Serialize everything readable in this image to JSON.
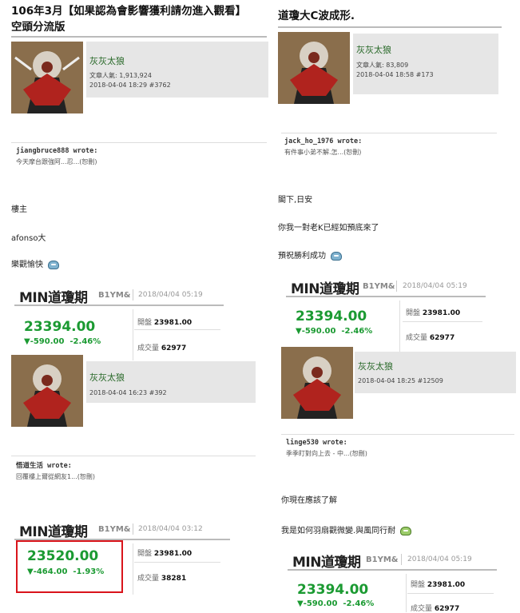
{
  "left": {
    "title_line1": "106年3月【如果認為會影響獲利請勿進入觀看】",
    "title_line2": "空頭分流版",
    "post1": {
      "username": "灰灰太狼",
      "stats": "文章人氣: 1,913,924",
      "datetime": "2018-04-04 18:29 #3762"
    },
    "quote1": {
      "header": "jiangbruce888 wrote:",
      "body": "今天摩台跟強阿...忍...(恕刪)"
    },
    "texts": [
      "樓主",
      "afonso大",
      "樂觀愉快"
    ],
    "card1": {
      "name": "MIN道瓊期",
      "code": "B1YM&",
      "date": "2018/04/04 05:19",
      "price": "23394.00",
      "change": "▼-590.00",
      "pct": "-2.46%",
      "open_label": "開盤",
      "open_value": "23981.00",
      "vol_label": "成交量",
      "vol_value": "62977"
    },
    "post2": {
      "username": "灰灰太狼",
      "datetime": "2018-04-04 16:23 #392"
    },
    "quote2": {
      "header": "悟道生活 wrote:",
      "body": "回覆樓上爾從網友1...(恕刪)"
    },
    "card2": {
      "name": "MIN道瓊期",
      "code": "B1YM&",
      "date": "2018/04/04 03:12",
      "price": "23520.00",
      "change": "▼-464.00",
      "pct": "-1.93%",
      "open_label": "開盤",
      "open_value": "23981.00",
      "vol_label": "成交量",
      "vol_value": "38281"
    }
  },
  "right": {
    "title": "道瓊大C波成形.",
    "post1": {
      "username": "灰灰太狼",
      "stats": "文章人氣: 83,809",
      "datetime": "2018-04-04 18:58 #173"
    },
    "quote1": {
      "header": "jack_ho_1976 wrote:",
      "body": "有件事小弟不解.怎...(恕刪)"
    },
    "texts": [
      "閣下,日安",
      "你我一對老K已經如預底來了",
      "預祝勝利成功"
    ],
    "card1": {
      "name": "MIN道瓊期",
      "code": "B1YM&",
      "date": "2018/04/04 05:19",
      "price": "23394.00",
      "change": "▼-590.00",
      "pct": "-2.46%",
      "open_label": "開盤",
      "open_value": "23981.00",
      "vol_label": "成交量",
      "vol_value": "62977"
    },
    "post2": {
      "username": "灰灰太狼",
      "datetime": "2018-04-04 18:25 #12509"
    },
    "quote2": {
      "header": "linge530 wrote:",
      "body": "季季盯對向上去 - 中...(恕刪)"
    },
    "texts2": [
      "你現在應該了解",
      "我是如何羽扇觀微變.與風同行耐"
    ],
    "card2": {
      "name": "MIN道瓊期",
      "code": "B1YM&",
      "date": "2018/04/04 05:19",
      "price": "23394.00",
      "change": "▼-590.00",
      "pct": "-2.46%",
      "open_label": "開盤",
      "open_value": "23981.00",
      "vol_label": "成交量",
      "vol_value": "62977"
    }
  },
  "colors": {
    "accent_green": "#1b9a32",
    "highlight_red": "#d9141b",
    "username_green": "#2a6a2a"
  },
  "icons": [
    "avatar-image",
    "blue-smiley-icon",
    "green-smiley-icon"
  ]
}
